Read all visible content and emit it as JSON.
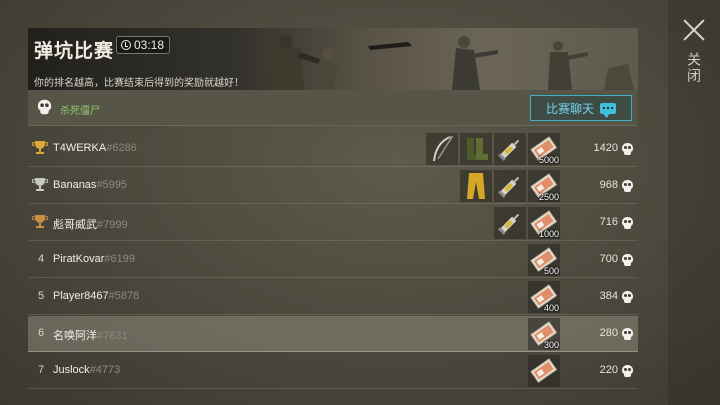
{
  "header": {
    "title": "弹坑比赛",
    "timer": "03:18",
    "subtitle": "你的排名越高，比赛结束后得到的奖励就越好！"
  },
  "filter": {
    "label": "杀死僵尸",
    "chat_button": "比赛聊天"
  },
  "close": {
    "label": "关闭"
  },
  "colors": {
    "accent_cyan": "#3fb0c8",
    "kill_green": "#8fc86a",
    "gold": "#d9a93a",
    "silver": "#c9c9c4",
    "bronze": "#c98f48"
  },
  "rows": [
    {
      "rank": "1",
      "trophy": "gold-trophy-icon",
      "name": "T4WERKA",
      "tag": "#6286",
      "score": "1420",
      "rewards": [
        {
          "icon": "scythe-icon",
          "qty": ""
        },
        {
          "icon": "boots-icon",
          "qty": ""
        },
        {
          "icon": "syringe-icon",
          "qty": ""
        },
        {
          "icon": "coupon-icon",
          "qty": "5000"
        }
      ]
    },
    {
      "rank": "2",
      "trophy": "silver-trophy-icon",
      "name": "Bananas",
      "tag": "#5995",
      "score": "968",
      "rewards": [
        {
          "icon": "pants-icon",
          "qty": ""
        },
        {
          "icon": "syringe-icon",
          "qty": ""
        },
        {
          "icon": "coupon-icon",
          "qty": "2500"
        }
      ]
    },
    {
      "rank": "3",
      "trophy": "bronze-trophy-icon",
      "name": "彪哥威武",
      "tag": "#7999",
      "score": "716",
      "rewards": [
        {
          "icon": "syringe-icon",
          "qty": ""
        },
        {
          "icon": "coupon-icon",
          "qty": "1000"
        }
      ]
    },
    {
      "rank": "4",
      "trophy": "",
      "name": "PiratKovar",
      "tag": "#6199",
      "score": "700",
      "rewards": [
        {
          "icon": "coupon-icon",
          "qty": "500"
        }
      ]
    },
    {
      "rank": "5",
      "trophy": "",
      "name": "Player8467",
      "tag": "#5878",
      "score": "384",
      "rewards": [
        {
          "icon": "coupon-icon",
          "qty": "400"
        }
      ]
    },
    {
      "rank": "6",
      "trophy": "",
      "name": "名唤阿洋",
      "tag": "#7631",
      "score": "280",
      "highlight": true,
      "rewards": [
        {
          "icon": "coupon-icon",
          "qty": "300"
        }
      ]
    },
    {
      "rank": "7",
      "trophy": "",
      "name": "Juslock",
      "tag": "#4773",
      "score": "220",
      "rewards": [
        {
          "icon": "coupon-icon",
          "qty": ""
        }
      ]
    }
  ]
}
